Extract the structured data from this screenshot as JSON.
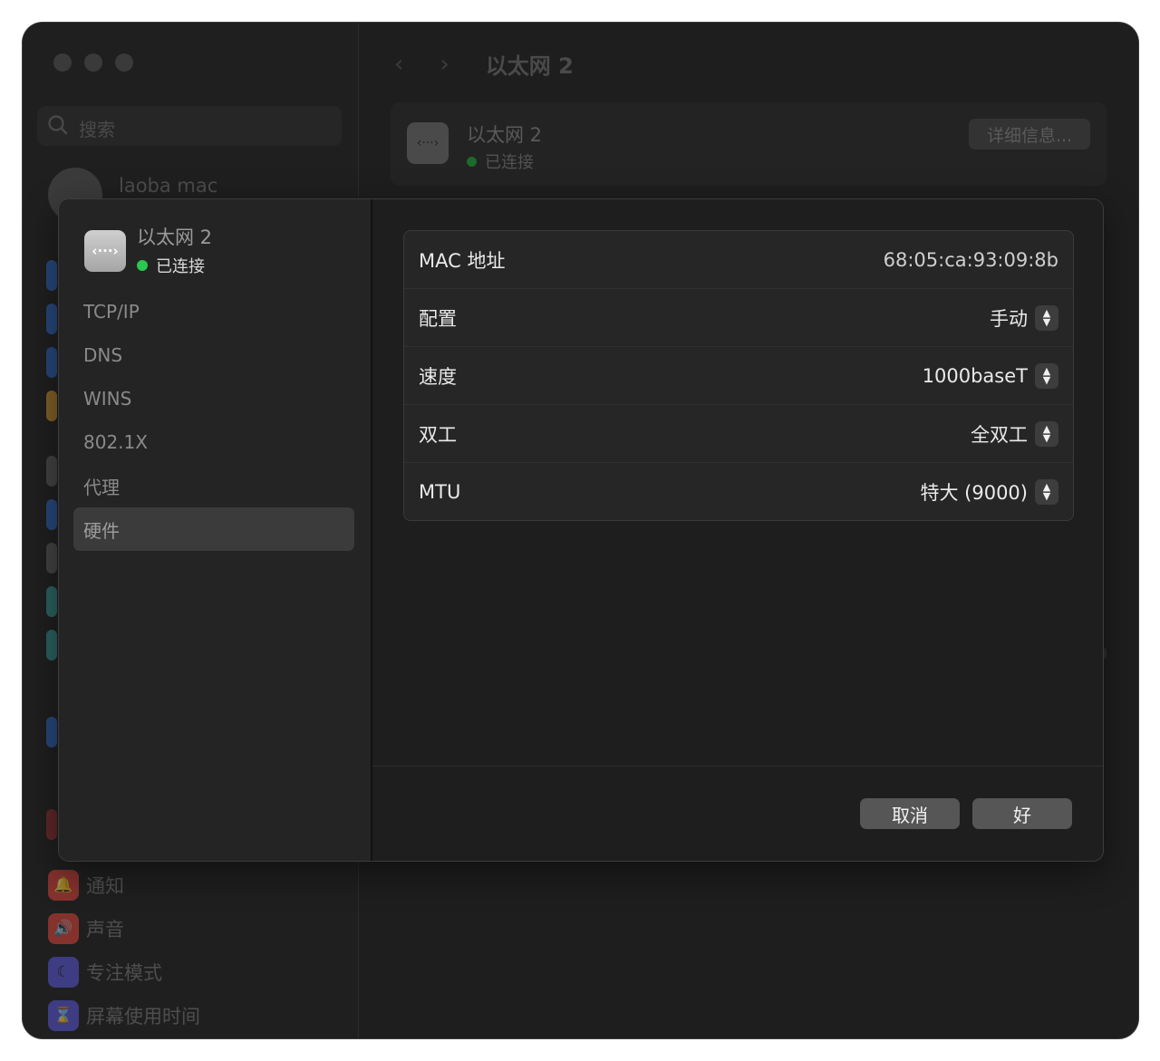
{
  "background": {
    "window_title": "以太网 2",
    "search_placeholder": "搜索",
    "user_name": "laoba mac",
    "device_card": {
      "name": "以太网 2",
      "status": "已连接",
      "details_button": "详细信息..."
    },
    "sidebar_items": [
      {
        "label": "通知",
        "icon": "bell-icon",
        "color": "#d9423a"
      },
      {
        "label": "声音",
        "icon": "speaker-icon",
        "color": "#d9423a"
      },
      {
        "label": "专注模式",
        "icon": "moon-icon",
        "color": "#5856d6"
      },
      {
        "label": "屏幕使用时间",
        "icon": "hourglass-icon",
        "color": "#5856d6"
      }
    ]
  },
  "sheet": {
    "device": {
      "name": "以太网 2",
      "status": "已连接",
      "status_color": "#2ac84c"
    },
    "tabs": [
      {
        "label": "TCP/IP",
        "active": false
      },
      {
        "label": "DNS",
        "active": false
      },
      {
        "label": "WINS",
        "active": false
      },
      {
        "label": "802.1X",
        "active": false
      },
      {
        "label": "代理",
        "active": false
      },
      {
        "label": "硬件",
        "active": true
      }
    ],
    "hardware": {
      "mac_label": "MAC 地址",
      "mac_value": "68:05:ca:93:09:8b",
      "config_label": "配置",
      "config_value": "手动",
      "speed_label": "速度",
      "speed_value": "1000baseT",
      "duplex_label": "双工",
      "duplex_value": "全双工",
      "mtu_label": "MTU",
      "mtu_value": "特大 (9000)"
    },
    "cancel_button": "取消",
    "ok_button": "好"
  }
}
